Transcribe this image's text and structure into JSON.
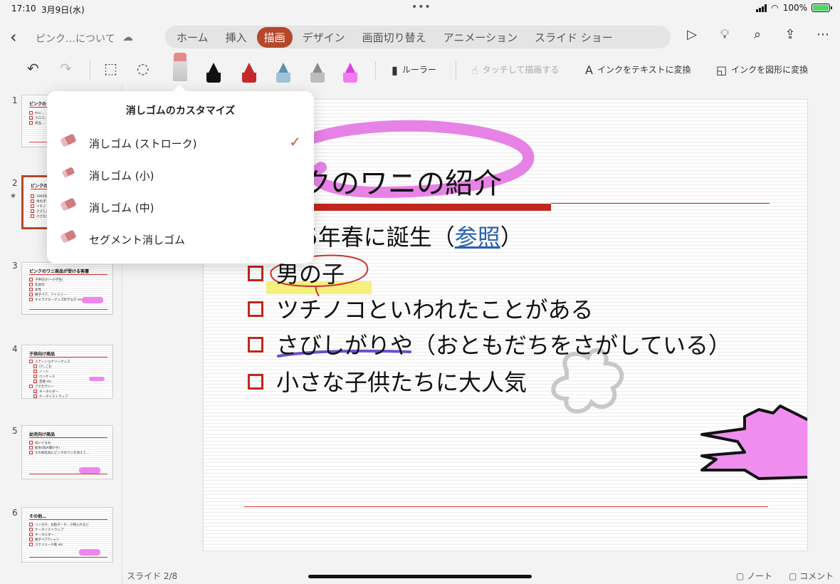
{
  "status": {
    "time": "17:10",
    "date": "3月9日(水)",
    "battery": "100%"
  },
  "header": {
    "document_title": "ピンク…について"
  },
  "tabs": [
    {
      "label": "ホーム"
    },
    {
      "label": "挿入"
    },
    {
      "label": "描画",
      "active": true
    },
    {
      "label": "デザイン"
    },
    {
      "label": "画面切り替え"
    },
    {
      "label": "アニメーション"
    },
    {
      "label": "スライド ショー"
    }
  ],
  "draw_toolbar": {
    "ruler": "ルーラー",
    "touch_draw": "タッチして描画する",
    "ink_to_text": "インクをテキストに変換",
    "ink_to_shape": "インクを図形に変換",
    "pen_colors": [
      "#111111",
      "#c62828",
      "#5a8fb0",
      "#8a8a8a",
      "#e040e0"
    ]
  },
  "eraser_popover": {
    "title": "消しゴムのカスタマイズ",
    "items": [
      {
        "label": "消しゴム (ストローク)",
        "checked": true
      },
      {
        "label": "消しゴム (小)"
      },
      {
        "label": "消しゴム (中)"
      },
      {
        "label": "セグメント消しゴム"
      }
    ]
  },
  "thumbnails": [
    {
      "number": "1",
      "title": "ピンクの",
      "lines": [
        "わに…",
        "クロコ…",
        "商品…"
      ]
    },
    {
      "number": "2",
      "title": "ピンクの",
      "lines": [
        "1995年",
        "男の子",
        "ツチノ",
        "さびしが",
        "小さな子"
      ]
    },
    {
      "number": "3",
      "title": "ピンクのワニ商品が受ける客層",
      "lines": [
        "子供向け(〜小学生)",
        "乳幼児",
        "女性",
        "親子ペア、ファミリー",
        "キャラクターグッズ好きな方 etc"
      ]
    },
    {
      "number": "4",
      "title": "子供向け商品",
      "lines": [
        "ステーショナリーグッズ",
        "けしごむ",
        "ノート",
        "ペンケース",
        "定規 etc",
        "アクセサリー",
        "キーホルダー",
        "ケータイストラップ"
      ]
    },
    {
      "number": "5",
      "title": "幼児向け商品",
      "lines": [
        "ぬいぐるみ",
        "絵本(読み聞かせ)",
        "その他玩具にピンクのワニを添えて…"
      ]
    },
    {
      "number": "6",
      "title": "その他…",
      "lines": [
        "ハンカチ、化粧ポーチ、小物入れなど",
        "ケータイストラップ",
        "キーホルダー",
        "親子ペアTシャツ",
        "スケジュール帳 etc"
      ]
    }
  ],
  "slide": {
    "title": "クのワニの紹介",
    "bullets": [
      {
        "text": "95年春に誕生（",
        "link": "参照",
        "after": "）"
      },
      {
        "text": "男の子"
      },
      {
        "text": "ツチノコといわれたことがある"
      },
      {
        "text": "さびしがりや（おともだちをさがしている）"
      },
      {
        "text": "小さな子供たちに大人気"
      }
    ]
  },
  "footer": {
    "slide_count": "スライド 2/8",
    "notes": "ノート",
    "comments": "コメント"
  }
}
